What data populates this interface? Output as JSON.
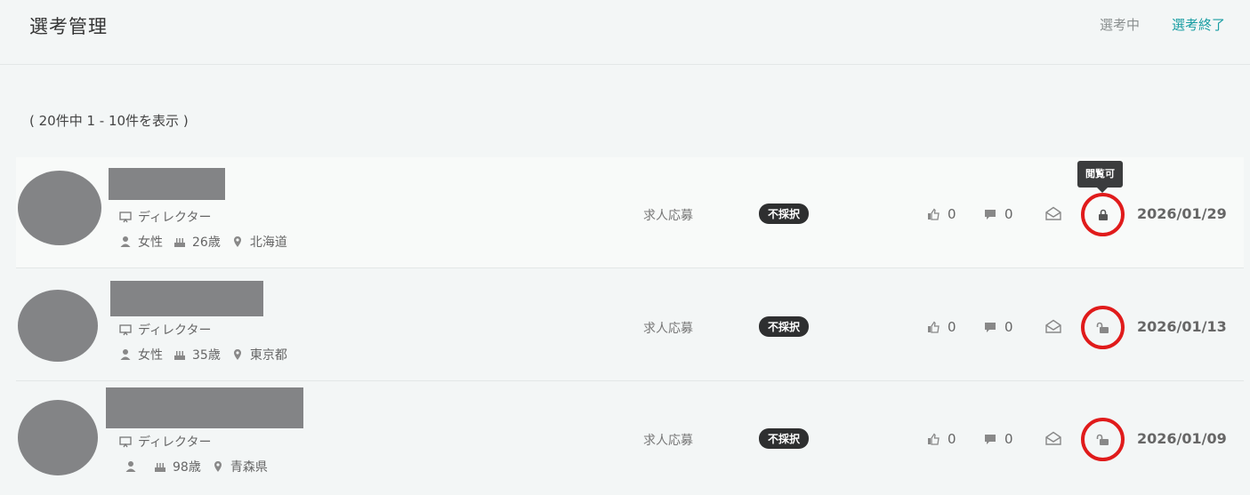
{
  "header": {
    "title": "選考管理",
    "tabs": [
      {
        "label": "選考中"
      },
      {
        "label": "選考終了"
      }
    ]
  },
  "summary": {
    "count_text": "( 20件中 1 - 10件を表示 )"
  },
  "tooltip": "閲覧可",
  "colors": {
    "accent": "#1a9ea3",
    "badge_bg": "#2e2f30",
    "highlight_ring": "#e01b1b",
    "redaction": "#838486"
  },
  "applicants": [
    {
      "role": "ディレクター",
      "gender": "女性",
      "age": "26歳",
      "location": "北海道",
      "source": "求人応募",
      "status": "不採択",
      "likes": "0",
      "comments": "0",
      "lock_icon": "lock-closed-icon",
      "date": "2026/01/29"
    },
    {
      "role": "ディレクター",
      "gender": "女性",
      "age": "35歳",
      "location": "東京都",
      "source": "求人応募",
      "status": "不採択",
      "likes": "0",
      "comments": "0",
      "lock_icon": "lock-open-icon",
      "date": "2026/01/13"
    },
    {
      "role": "ディレクター",
      "gender": "",
      "age": "98歳",
      "location": "青森県",
      "source": "求人応募",
      "status": "不採択",
      "likes": "0",
      "comments": "0",
      "lock_icon": "lock-open-icon",
      "date": "2026/01/09"
    }
  ]
}
